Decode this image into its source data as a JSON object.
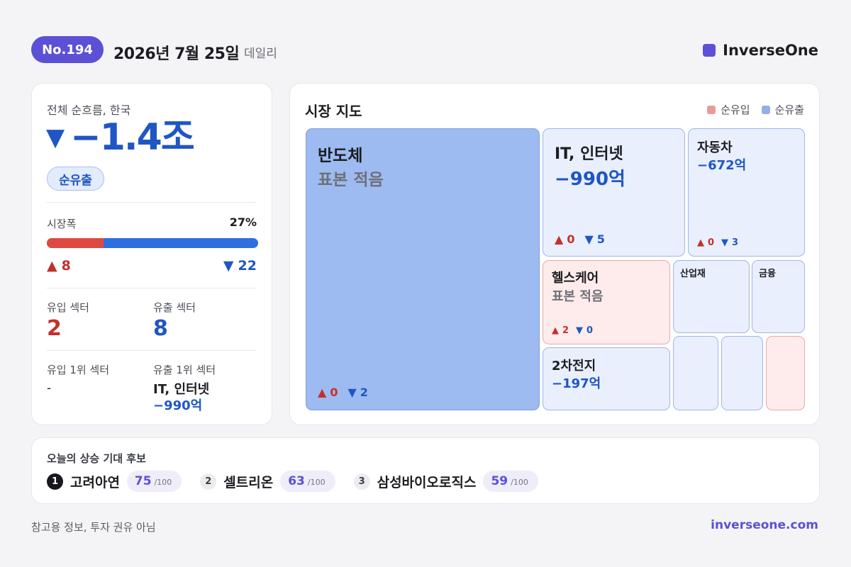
{
  "header": {
    "issue_no": "No.194",
    "date": "2026년 7월 25일",
    "frequency": "데일리",
    "brand": "InverseOne",
    "brand_color": "#5b50d6"
  },
  "summary": {
    "label": "전체 순흐름, 한국",
    "value_arrow": "▼",
    "value": "−1.4조",
    "direction_badge": "순유출",
    "breadth_label": "시장폭",
    "breadth_pct": "27%",
    "breadth_fraction": 0.27,
    "advancers": "8",
    "decliners": "22",
    "inflow_sectors_label": "유입 섹터",
    "inflow_sectors": "2",
    "outflow_sectors_label": "유출 섹터",
    "outflow_sectors": "8",
    "top_inflow_label": "유입 1위 섹터",
    "top_inflow_value": "-",
    "top_outflow_label": "유출 1위 섹터",
    "top_outflow_name": "IT, 인터넷",
    "top_outflow_value": "−990억"
  },
  "market_map": {
    "title": "시장 지도",
    "legend_inflow": "순유입",
    "legend_outflow": "순유출",
    "inflow_color": "#ea9b97",
    "outflow_color": "#8fb0ea",
    "tiles": [
      {
        "name": "반도체",
        "value": "표본 적음",
        "up": "0",
        "down": "2"
      },
      {
        "name": "IT, 인터넷",
        "value": "−990억",
        "up": "0",
        "down": "5"
      },
      {
        "name": "자동차",
        "value": "−672억",
        "up": "0",
        "down": "3"
      },
      {
        "name": "헬스케어",
        "value": "표본 적음",
        "up": "2",
        "down": "0"
      },
      {
        "name": "산업재"
      },
      {
        "name": "금융"
      },
      {
        "name": "2차전지",
        "value": "−197억"
      }
    ],
    "up_arrow": "▲",
    "down_arrow": "▼"
  },
  "candidates": {
    "title": "오늘의 상승 기대 후보",
    "items": [
      {
        "rank": "1",
        "name": "고려아연",
        "score": "75",
        "max": "/100"
      },
      {
        "rank": "2",
        "name": "셀트리온",
        "score": "63",
        "max": "/100"
      },
      {
        "rank": "3",
        "name": "삼성바이오로직스",
        "score": "59",
        "max": "/100"
      }
    ]
  },
  "footer": {
    "disclaimer": "참고용 정보, 투자 권유 아님",
    "site": "inverseone.com"
  }
}
